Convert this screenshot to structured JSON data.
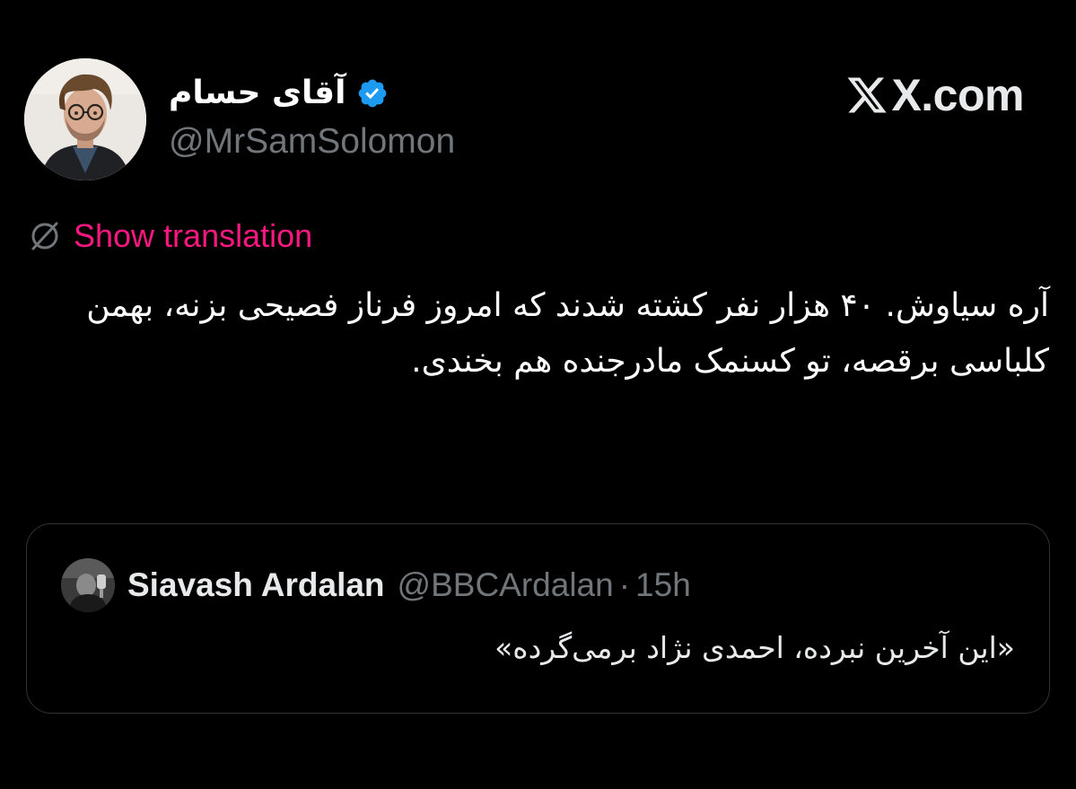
{
  "tweet": {
    "author": {
      "display_name": "آقای حسام",
      "handle": "@MrSamSolomon",
      "verified": true,
      "verified_icon": "verified-badge-icon",
      "verified_color": "#1d9bf0"
    },
    "site_label": "X.com",
    "translate": {
      "icon": "translate-globe-icon",
      "label": "Show translation",
      "color": "#f91880"
    },
    "text": "آره سیاوش. ۴۰ هزار نفر کشته شدند که امروز فرناز فصیحی بزنه، بهمن کلباسی برقصه، تو کسنمک مادرجنده هم بخندی."
  },
  "quoted_tweet": {
    "author_name": "Siavash Ardalan",
    "handle": "@BBCArdalan",
    "separator": "·",
    "time": "15h",
    "text": "«این آخرین نبرده، احمدی نژاد برمی‌گرده»"
  },
  "colors": {
    "background": "#000000",
    "text_primary": "#ffffff",
    "text_secondary": "#71767b",
    "border": "#2f3336"
  }
}
